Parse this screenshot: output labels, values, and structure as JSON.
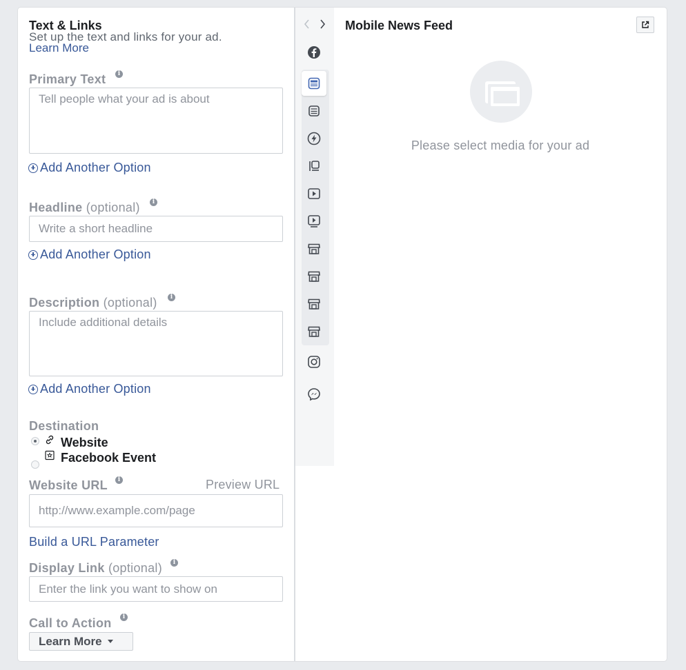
{
  "text_links": {
    "title": "Text & Links",
    "subtitle": "Set up the text and links for your ad.",
    "learn_more": "Learn More"
  },
  "primary_text": {
    "label": "Primary Text",
    "placeholder": "Tell people what your ad is about",
    "add_option": "Add Another Option"
  },
  "headline": {
    "label": "Headline",
    "optional": "(optional)",
    "placeholder": "Write a short headline",
    "add_option": "Add Another Option"
  },
  "description": {
    "label": "Description",
    "optional": "(optional)",
    "placeholder": "Include additional details",
    "add_option": "Add Another Option"
  },
  "destination": {
    "label": "Destination",
    "options": [
      {
        "label": "Website",
        "selected": true,
        "icon": "link-icon"
      },
      {
        "label": "Facebook Event",
        "selected": false,
        "icon": "event-icon"
      }
    ]
  },
  "website_url": {
    "label": "Website URL",
    "preview_link": "Preview URL",
    "placeholder": "http://www.example.com/page",
    "build_param": "Build a URL Parameter"
  },
  "display_link": {
    "label": "Display Link",
    "optional": "(optional)",
    "placeholder": "Enter the link you want to show on"
  },
  "call_to_action": {
    "label": "Call to Action",
    "value": "Learn More"
  },
  "preview": {
    "title": "Mobile News Feed",
    "empty_message": "Please select media for your ad"
  },
  "placement_icons": [
    "facebook-icon",
    "mobile-news-feed-icon",
    "feed-icon",
    "instant-articles-icon",
    "right-column-icon",
    "video-icon",
    "in-stream-video-icon",
    "marketplace-icon",
    "marketplace-icon-2",
    "marketplace-icon-3",
    "marketplace-icon-4",
    "instagram-icon",
    "messenger-icon"
  ],
  "colors": {
    "link": "#385898",
    "label": "#90949c",
    "selected": "#4267b2"
  }
}
